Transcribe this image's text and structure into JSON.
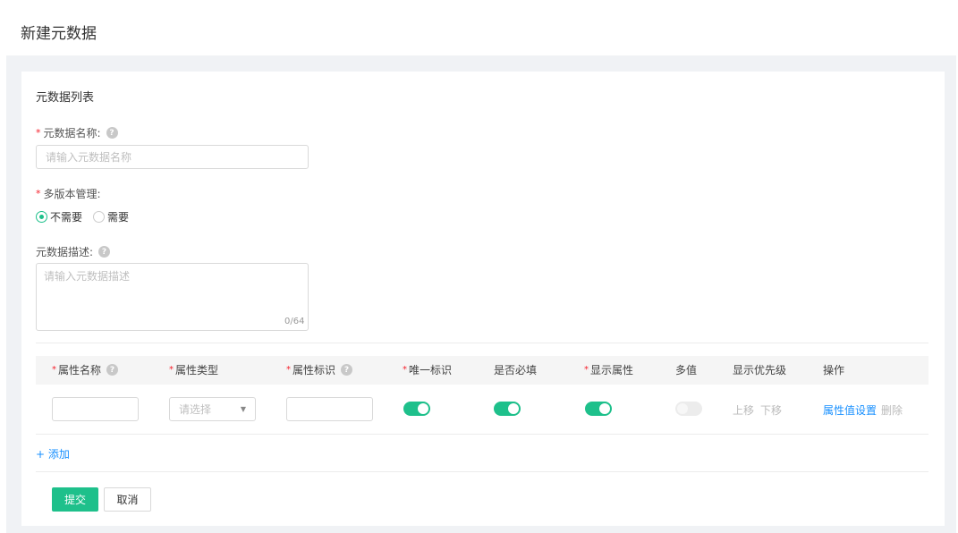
{
  "page": {
    "title": "新建元数据",
    "section_title": "元数据列表"
  },
  "form": {
    "name": {
      "label": "元数据名称:",
      "placeholder": "请输入元数据名称",
      "required_mark": "*",
      "help": "?"
    },
    "versioning": {
      "label": "多版本管理:",
      "required_mark": "*",
      "options": [
        "不需要",
        "需要"
      ],
      "selected": "不需要"
    },
    "description": {
      "label": "元数据描述:",
      "placeholder": "请输入元数据描述",
      "help": "?",
      "counter": "0/64"
    }
  },
  "table": {
    "required_mark": "*",
    "help": "?",
    "columns": [
      "属性名称",
      "属性类型",
      "属性标识",
      "唯一标识",
      "是否必填",
      "显示属性",
      "多值",
      "显示优先级",
      "操作"
    ],
    "row": {
      "type_placeholder": "请选择",
      "unique": true,
      "required": true,
      "display": true,
      "multi": false,
      "move_up": "上移",
      "move_down": "下移",
      "attr_settings": "属性值设置",
      "delete": "删除"
    },
    "add_label": "+ 添加"
  },
  "actions": {
    "submit": "提交",
    "cancel": "取消"
  },
  "colors": {
    "primary": "#1ec08b",
    "link": "#1890ff",
    "required": "#f5222d"
  }
}
